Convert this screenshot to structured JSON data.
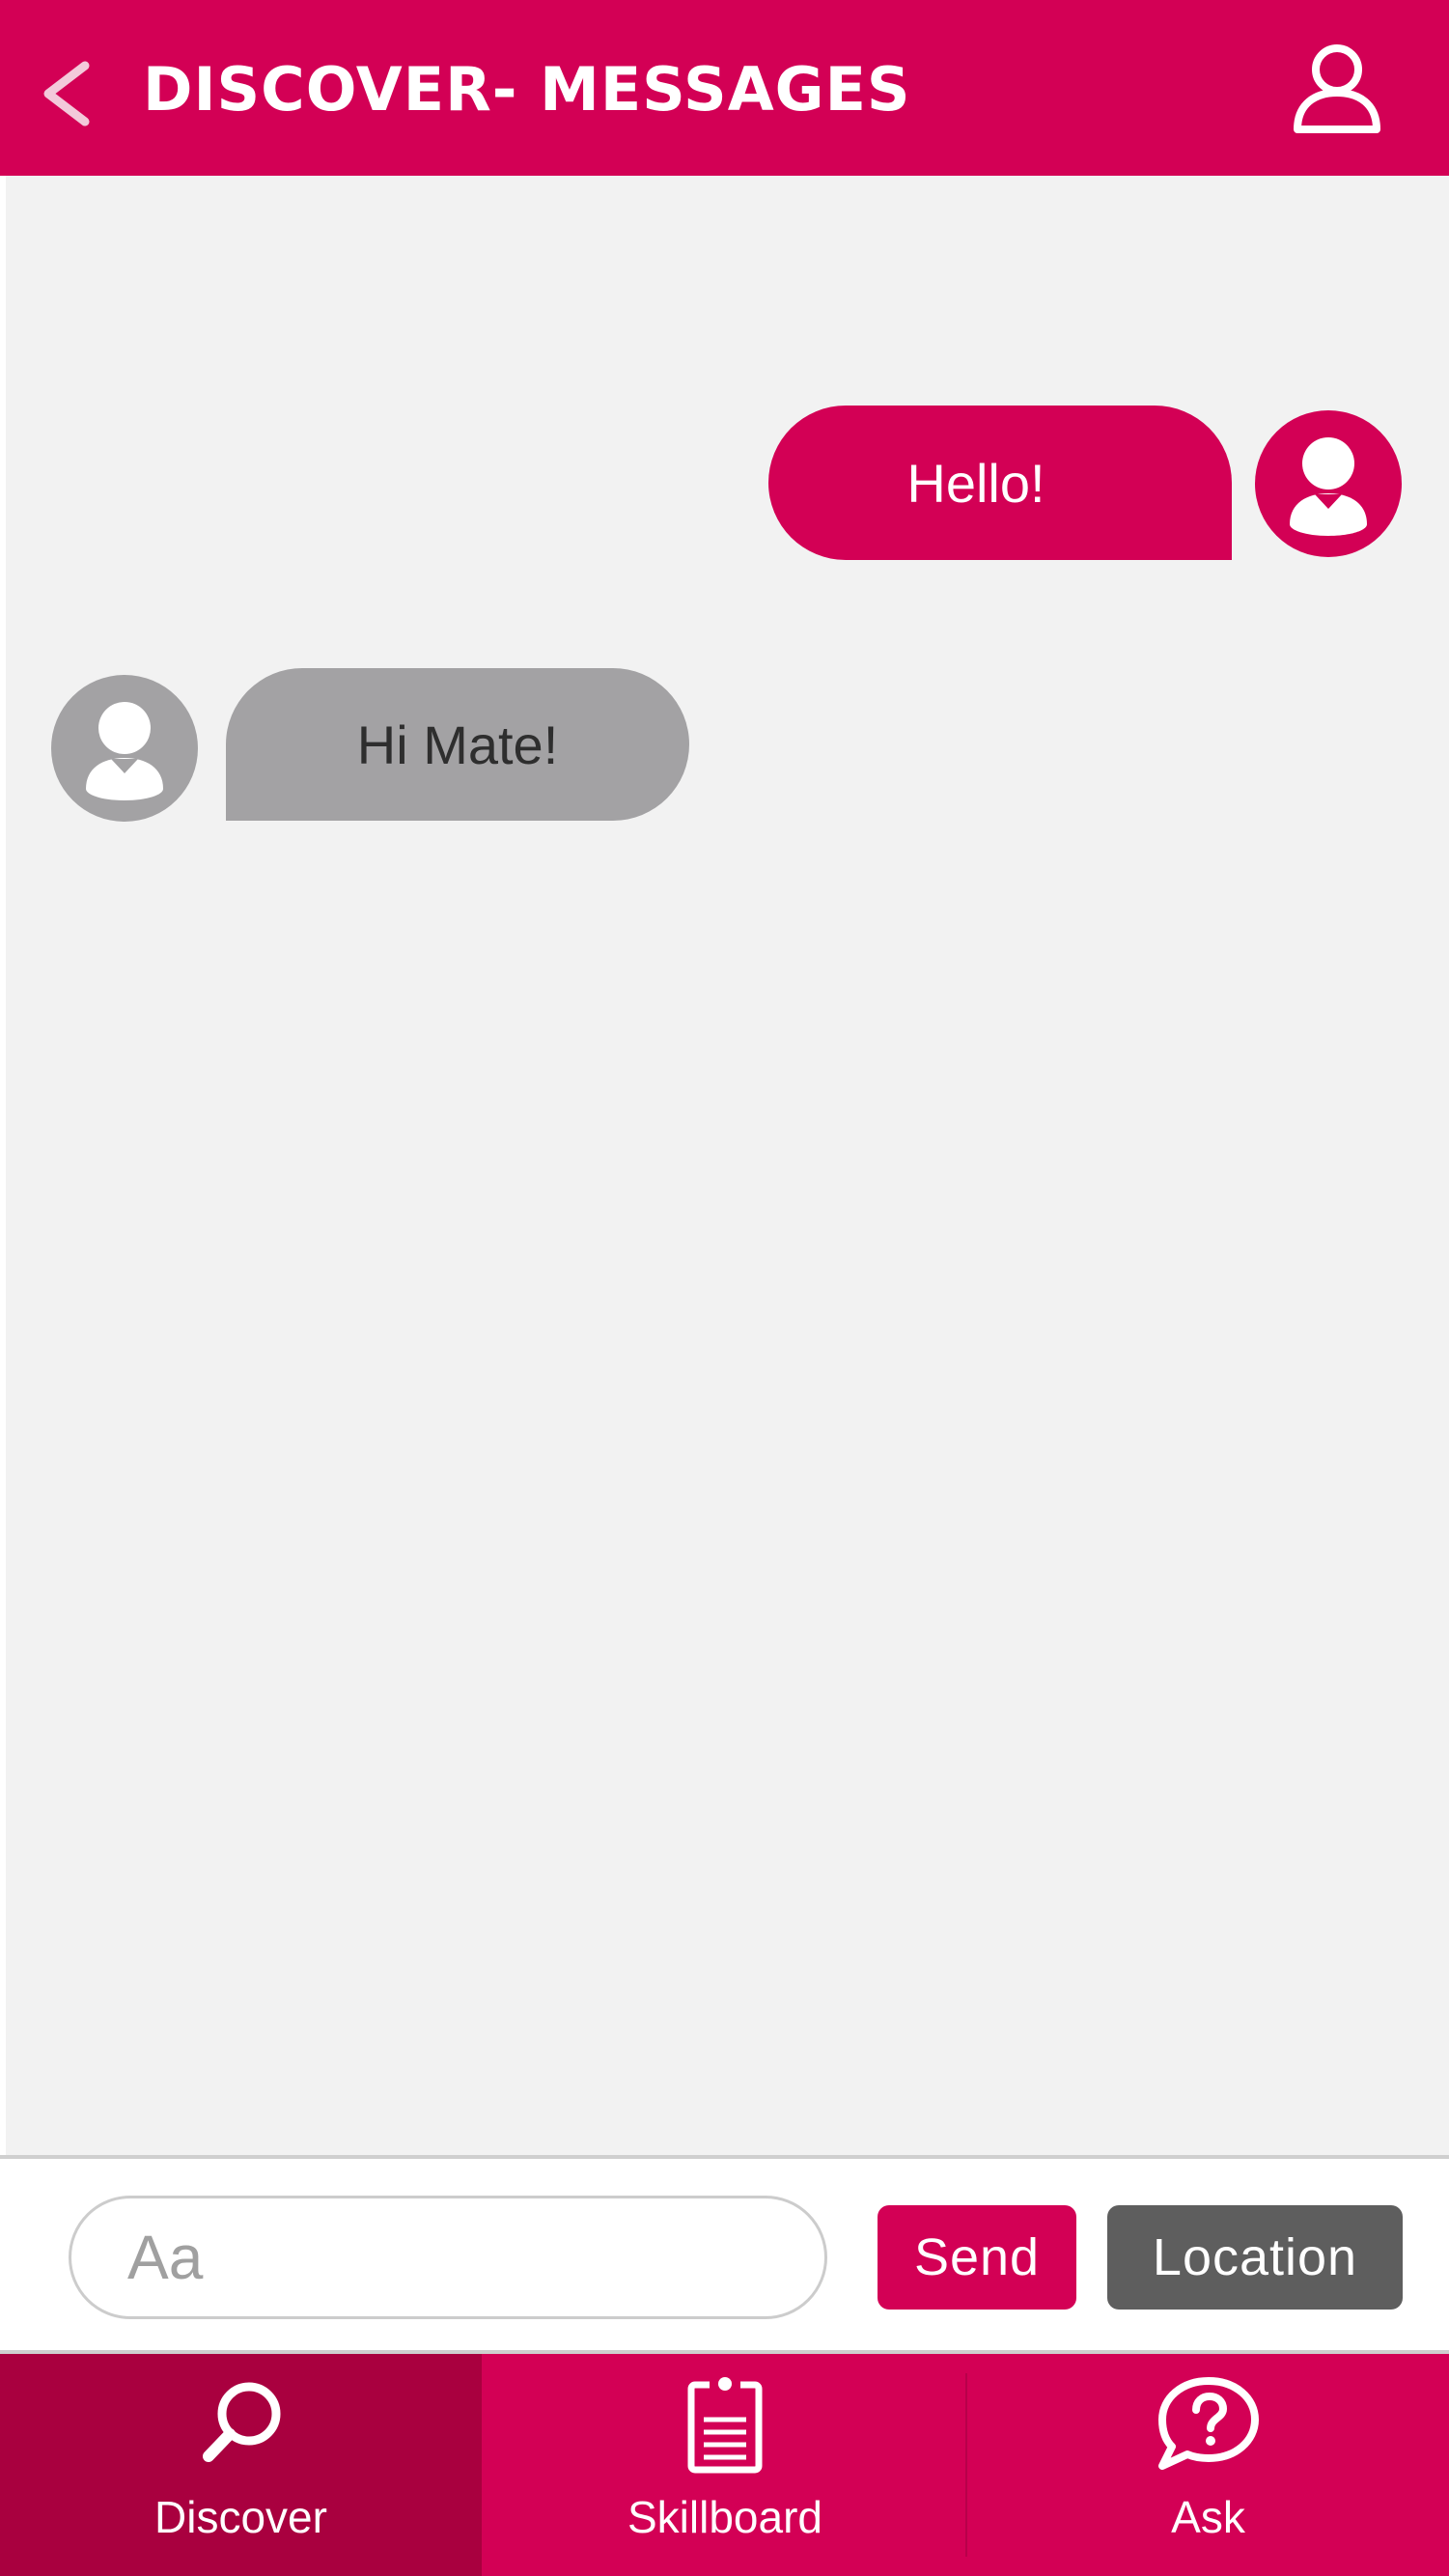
{
  "header": {
    "title": "DISCOVER- MESSAGES",
    "back_icon": "chevron-left-icon",
    "profile_icon": "user-outline-icon"
  },
  "messages": [
    {
      "sender": "me",
      "text": "Hello!"
    },
    {
      "sender": "other",
      "text": "Hi Mate!"
    }
  ],
  "composer": {
    "input_value": "",
    "input_placeholder": "Aa",
    "send_label": "Send",
    "location_label": "Location"
  },
  "nav": {
    "tabs": [
      {
        "label": "Discover",
        "icon": "search-icon",
        "active": true
      },
      {
        "label": "Skillboard",
        "icon": "clipboard-icon",
        "active": false
      },
      {
        "label": "Ask",
        "icon": "question-bubble-icon",
        "active": false
      }
    ]
  },
  "colors": {
    "brand": "#d30055",
    "brand_dark": "#a9003f",
    "received_bubble": "#a3a2a4",
    "location_button": "#5e5e5e",
    "chat_background": "#f2f2f2"
  }
}
